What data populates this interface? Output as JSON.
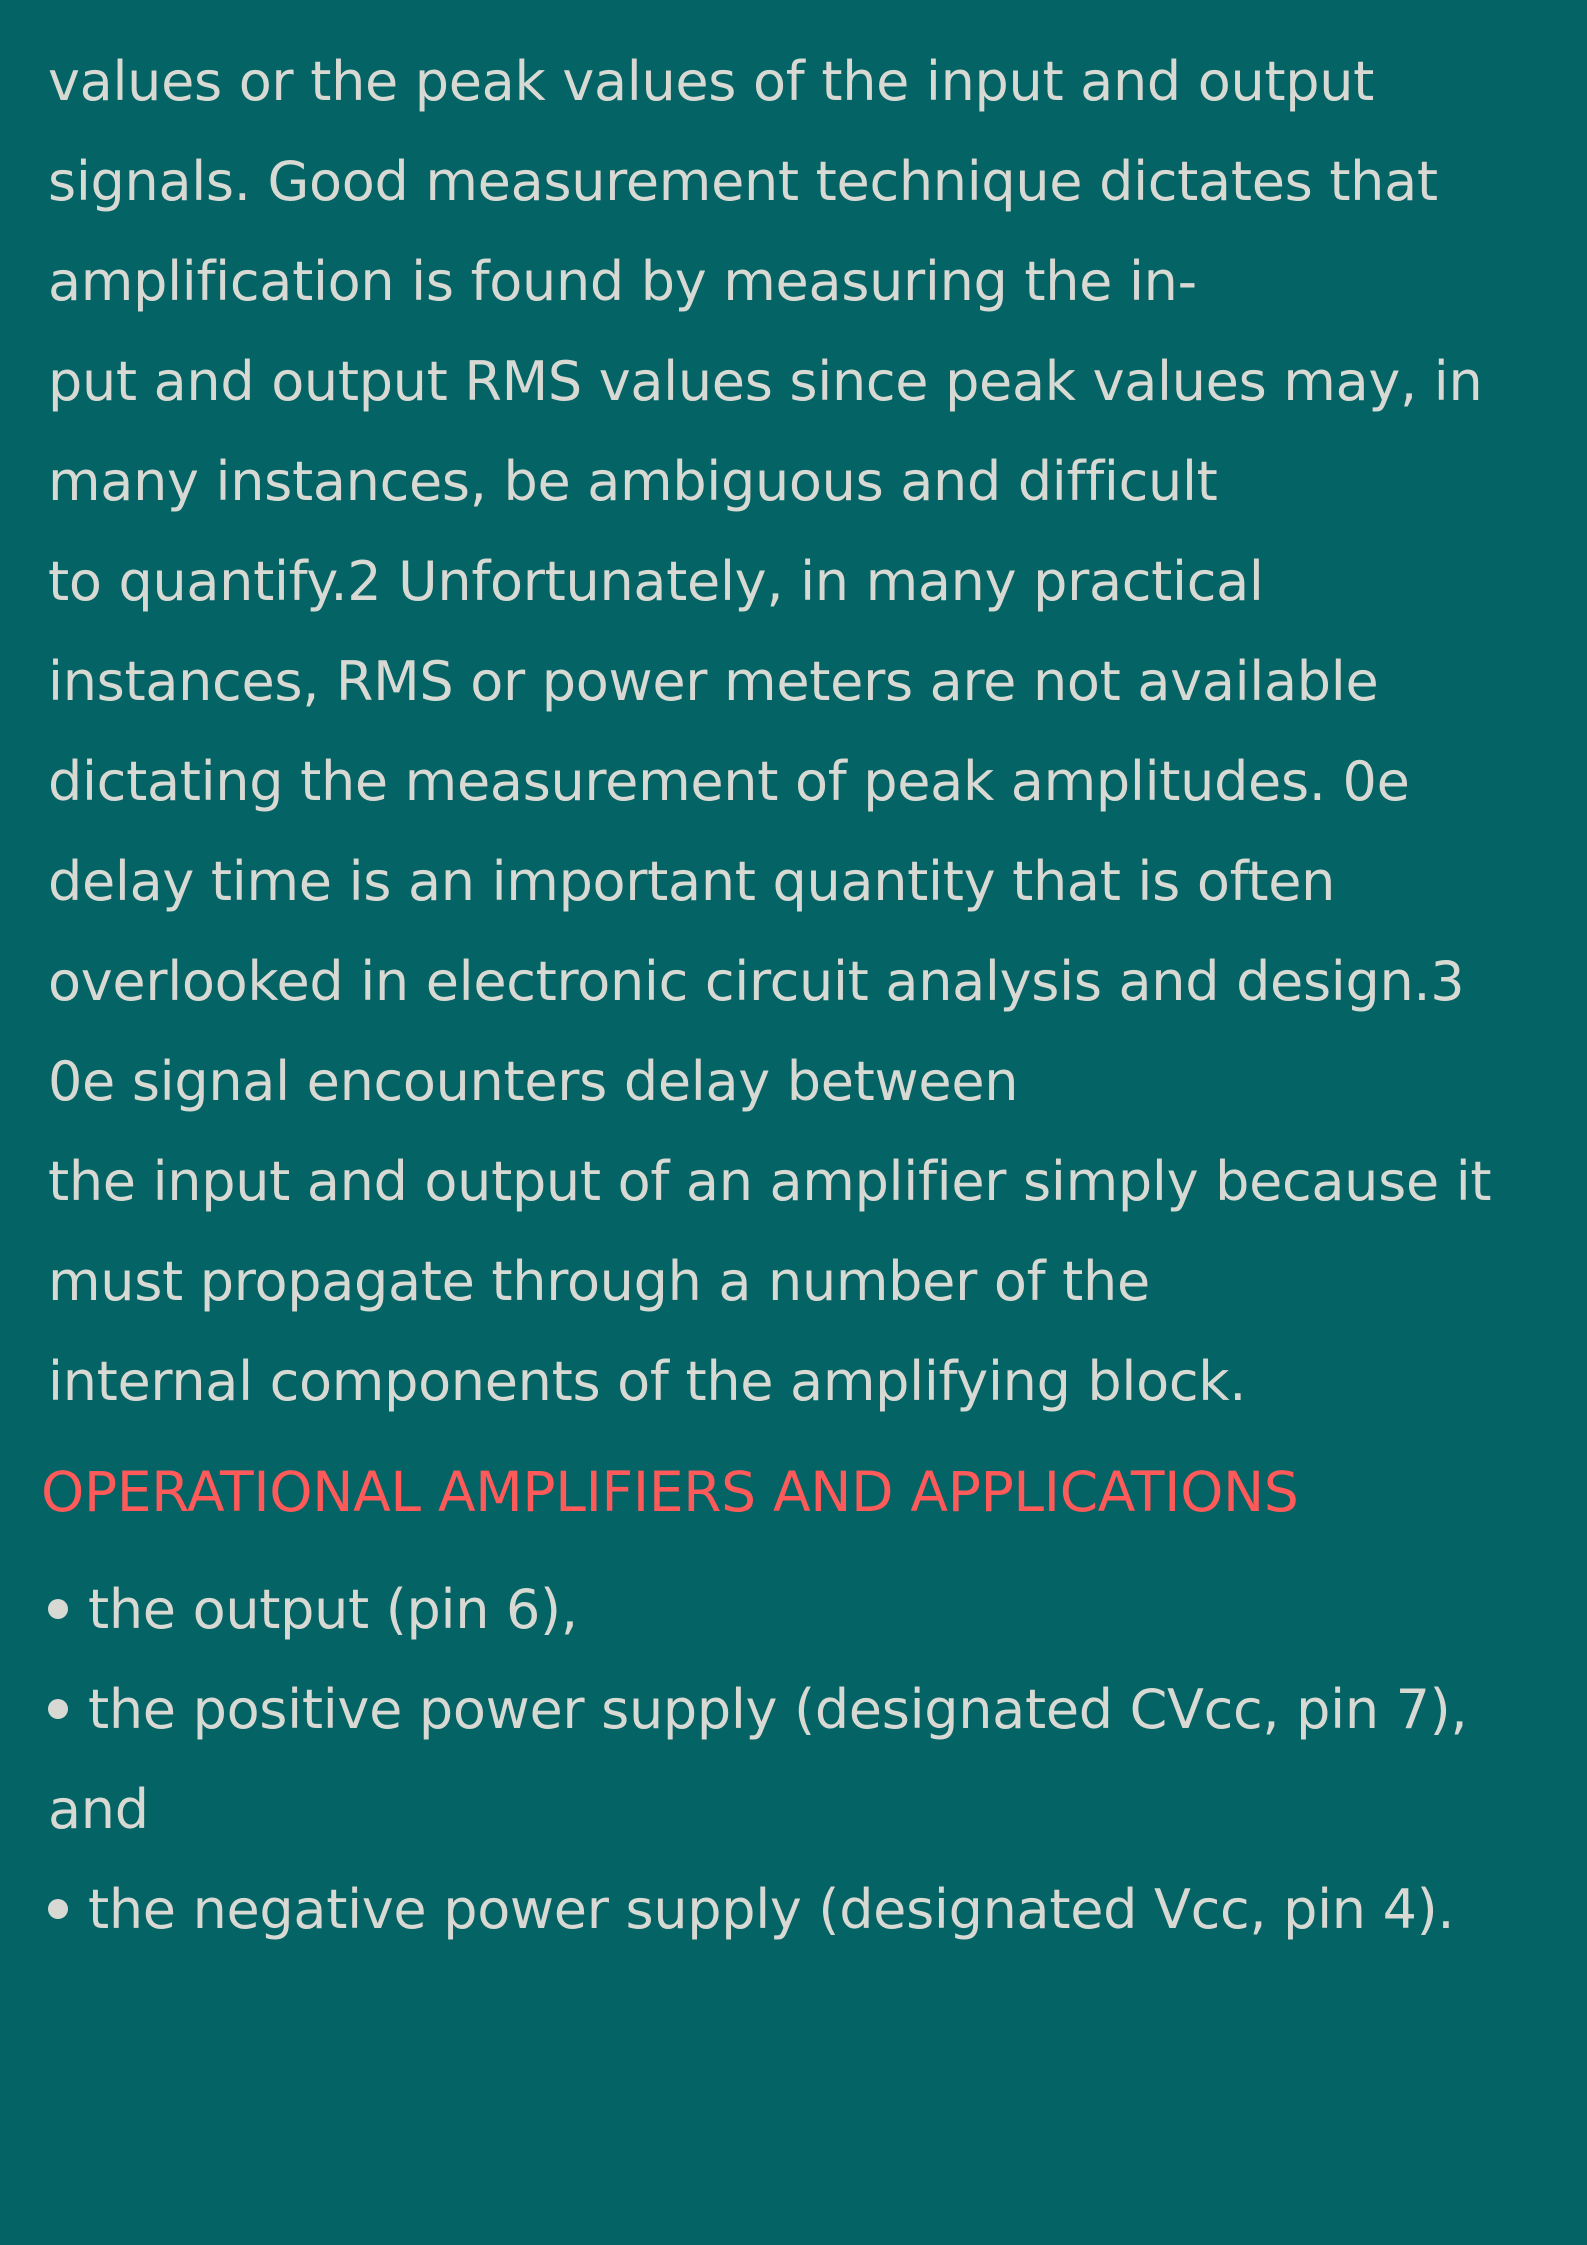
{
  "document": {
    "body_lines": [
      "values or the peak values of the input and output",
      "signals. Good measurement technique dictates that",
      "amplification is found by measuring the in-",
      "put and output RMS values since peak values may, in",
      "many instances, be ambiguous and difficult",
      "to quantify.2 Unfortunately, in many practical",
      "instances, RMS or power meters are not available",
      "dictating the measurement of peak amplitudes. 0e",
      "delay time is an important quantity that is often",
      "overlooked in electronic circuit analysis and design.3",
      "0e signal encounters delay between",
      "the input and output of an amplifier simply because it",
      "must propagate through a number of the",
      "internal components of the amplifying block."
    ],
    "section_heading": "OPERATIONAL AMPLIFIERS AND APPLICATIONS",
    "list_items": [
      "the output (pin 6),",
      "the positive power supply (designated CVcc, pin 7),",
      "and",
      "the negative power supply (designated Vcc, pin 4)."
    ],
    "colors": {
      "background": "#036365",
      "text": "#d9d9d4",
      "heading": "#ff5a5a"
    }
  }
}
